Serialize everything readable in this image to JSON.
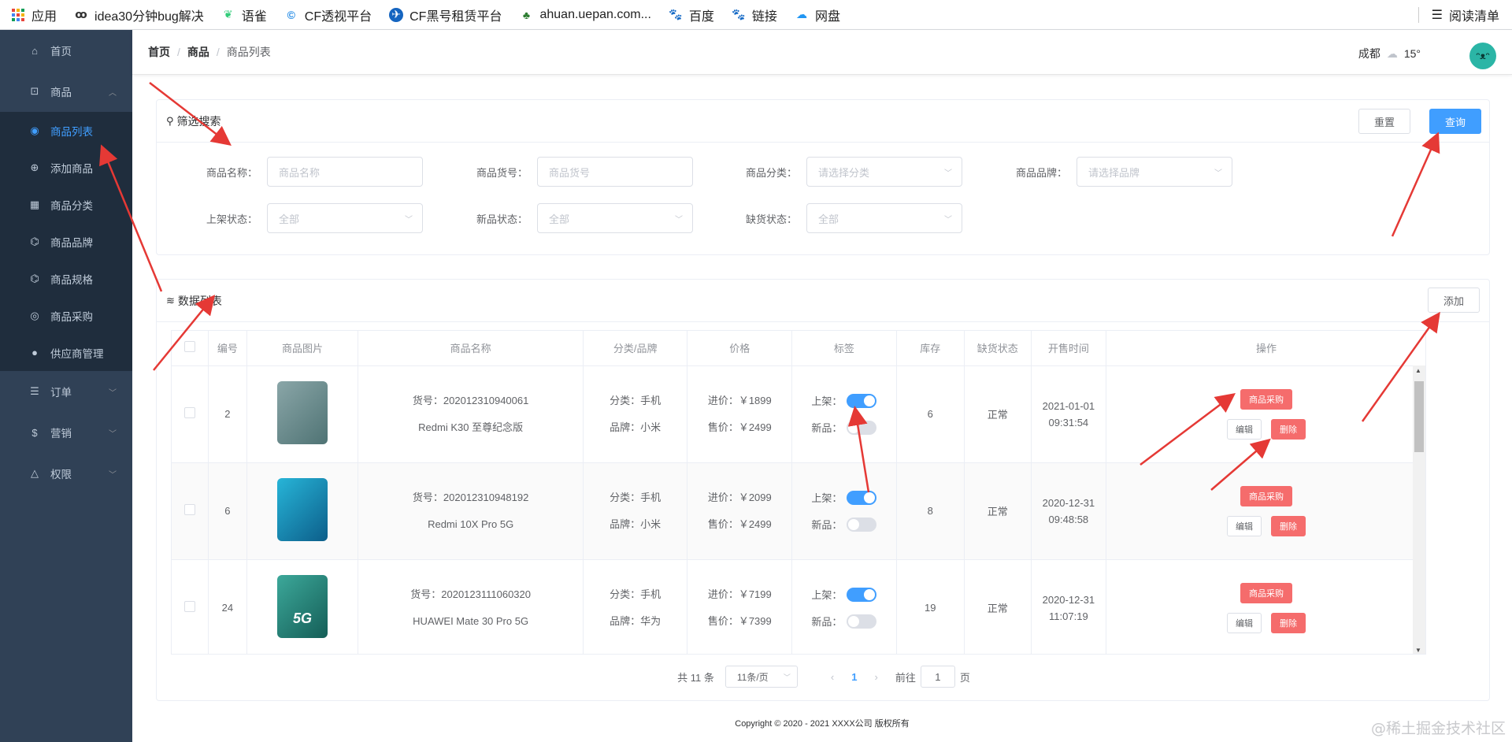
{
  "bookmarks": [
    {
      "icon": "apps-grid-icon",
      "label": "应用"
    },
    {
      "icon": "idea-icon",
      "label": "idea30分钟bug解决"
    },
    {
      "icon": "yuque-icon",
      "label": "语雀"
    },
    {
      "icon": "cf-icon",
      "label": "CF透视平台"
    },
    {
      "icon": "cf-rent-icon",
      "label": "CF黑号租赁平台"
    },
    {
      "icon": "tree-icon",
      "label": "ahuan.uepan.com..."
    },
    {
      "icon": "baidu-paw-icon",
      "label": "百度"
    },
    {
      "icon": "baidu-paw-icon",
      "label": "链接"
    },
    {
      "icon": "cloud-drive-icon",
      "label": "网盘"
    }
  ],
  "reading_list": "阅读清单",
  "sidebar": {
    "items": [
      {
        "label": "首页",
        "icon": "home-icon"
      },
      {
        "label": "商品",
        "icon": "bag-icon"
      },
      {
        "label": "订单",
        "icon": "list-icon"
      },
      {
        "label": "营销",
        "icon": "dollar-icon"
      },
      {
        "label": "权限",
        "icon": "bell-icon"
      }
    ],
    "sub_items": [
      {
        "label": "商品列表",
        "icon": "location-icon"
      },
      {
        "label": "添加商品",
        "icon": "plus-circle-icon"
      },
      {
        "label": "商品分类",
        "icon": "grid-icon"
      },
      {
        "label": "商品品牌",
        "icon": "brand-icon"
      },
      {
        "label": "商品规格",
        "icon": "spec-icon"
      },
      {
        "label": "商品采购",
        "icon": "purchase-icon"
      },
      {
        "label": "供应商管理",
        "icon": "user-icon"
      }
    ]
  },
  "breadcrumb": {
    "home": "首页",
    "section": "商品",
    "current": "商品列表"
  },
  "weather": {
    "city": "成都",
    "temp": "15°"
  },
  "filter": {
    "title": "筛选搜索",
    "reset": "重置",
    "query": "查询",
    "fields": [
      {
        "label": "商品名称：",
        "placeholder": "商品名称"
      },
      {
        "label": "商品货号：",
        "placeholder": "商品货号"
      },
      {
        "label": "商品分类：",
        "placeholder": "请选择分类"
      },
      {
        "label": "商品品牌：",
        "placeholder": "请选择品牌"
      },
      {
        "label": "上架状态：",
        "placeholder": "全部"
      },
      {
        "label": "新品状态：",
        "placeholder": "全部"
      },
      {
        "label": "缺货状态：",
        "placeholder": "全部"
      }
    ]
  },
  "list": {
    "title": "数据列表",
    "add": "添加",
    "headers": [
      "编号",
      "商品图片",
      "商品名称",
      "分类/品牌",
      "价格",
      "标签",
      "库存",
      "缺货状态",
      "开售时间",
      "操作"
    ],
    "rows": [
      {
        "id": "2",
        "sku": "货号：202012310940061",
        "name": "Redmi K30 至尊纪念版",
        "cat": "分类：手机",
        "brand": "品牌：小米",
        "in": "进价：￥1899",
        "out": "售价：￥2499",
        "on_label": "上架：",
        "new_label": "新品：",
        "on": true,
        "new": false,
        "stock": "6",
        "status": "正常",
        "date": "2021-01-01",
        "time": "09:31:54"
      },
      {
        "id": "6",
        "sku": "货号：202012310948192",
        "name": "Redmi 10X Pro 5G",
        "cat": "分类：手机",
        "brand": "品牌：小米",
        "in": "进价：￥2099",
        "out": "售价：￥2499",
        "on_label": "上架：",
        "new_label": "新品：",
        "on": true,
        "new": false,
        "stock": "8",
        "status": "正常",
        "date": "2020-12-31",
        "time": "09:48:58"
      },
      {
        "id": "24",
        "sku": "货号：2020123111060320",
        "name": "HUAWEI Mate 30 Pro 5G",
        "cat": "分类：手机",
        "brand": "品牌：华为",
        "in": "进价：￥7199",
        "out": "售价：￥7399",
        "on_label": "上架：",
        "new_label": "新品：",
        "on": true,
        "new": false,
        "stock": "19",
        "status": "正常",
        "date": "2020-12-31",
        "time": "11:07:19",
        "img_text": "5G"
      }
    ],
    "op_purchase": "商品采购",
    "op_edit": "编辑",
    "op_delete": "删除"
  },
  "pager": {
    "total": "共 11 条",
    "size": "11条/页",
    "page": "1",
    "goto": "前往",
    "goto_val": "1",
    "page_unit": "页"
  },
  "footer": "Copyright © 2020 - 2021  XXXX公司 版权所有",
  "watermark": "@稀土掘金技术社区",
  "colors": {
    "sidebar": "#304156",
    "accent": "#409eff",
    "danger": "#f56c6c",
    "arrow": "#e53935"
  }
}
